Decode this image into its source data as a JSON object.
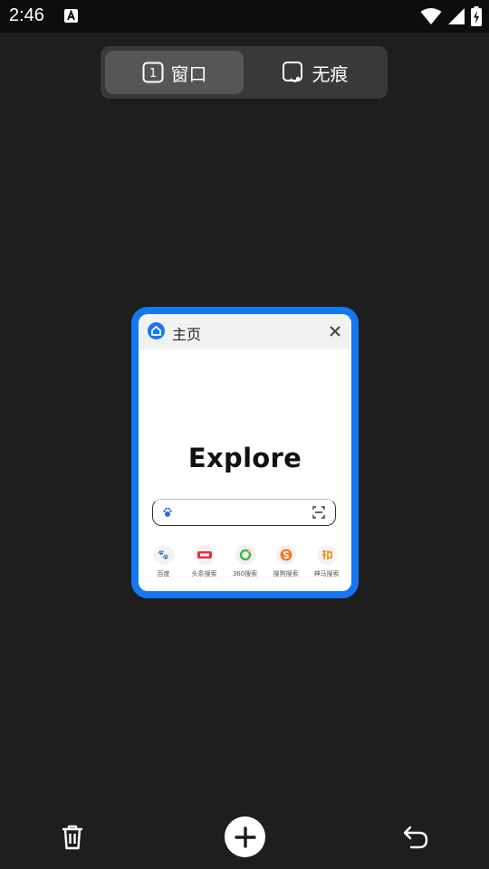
{
  "status": {
    "time": "2:46",
    "icons": [
      "font-a-icon",
      "wifi-icon",
      "signal-icon",
      "battery-charging-icon"
    ]
  },
  "tabs_switcher": {
    "windows_label": "窗口",
    "windows_count": "1",
    "incognito_label": "无痕"
  },
  "tab_card": {
    "title": "主页",
    "logo_text": "Explore",
    "shortcuts": [
      {
        "label": "百度",
        "icon": "baidu-paw-icon",
        "color": "#2f6ae0"
      },
      {
        "label": "头条搜索",
        "icon": "toutiao-icon",
        "color": "#e6323a"
      },
      {
        "label": "360搜索",
        "icon": "so360-icon",
        "color": "#3bb54a"
      },
      {
        "label": "搜狗搜索",
        "icon": "sogou-icon",
        "color": "#f57a20"
      },
      {
        "label": "神马搜索",
        "icon": "shenma-icon",
        "color": "#f08a00"
      }
    ]
  },
  "colors": {
    "accent": "#1677f2",
    "background": "#1f1e1f"
  },
  "bottom_bar": {
    "icons": [
      "trash-icon",
      "add-tab-icon",
      "undo-icon"
    ]
  }
}
